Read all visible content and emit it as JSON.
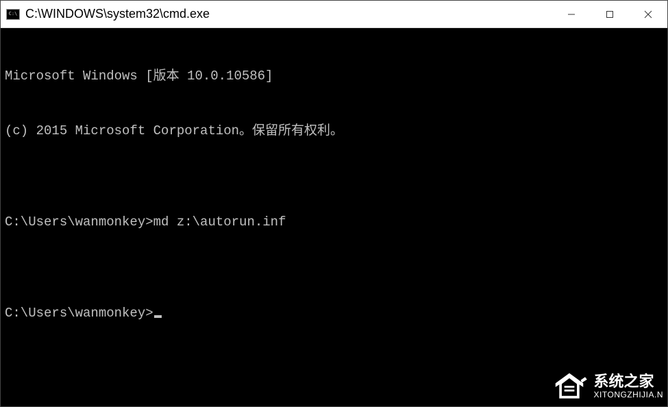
{
  "window": {
    "title": "C:\\WINDOWS\\system32\\cmd.exe"
  },
  "terminal": {
    "line1": "Microsoft Windows [版本 10.0.10586]",
    "line2": "(c) 2015 Microsoft Corporation。保留所有权利。",
    "blank1": "",
    "prompt1": "C:\\Users\\wanmonkey>md z:\\autorun.inf",
    "blank2": "",
    "prompt2": "C:\\Users\\wanmonkey>"
  },
  "watermark": {
    "name_cn": "系统之家",
    "url": "XITONGZHIJIA.N"
  }
}
